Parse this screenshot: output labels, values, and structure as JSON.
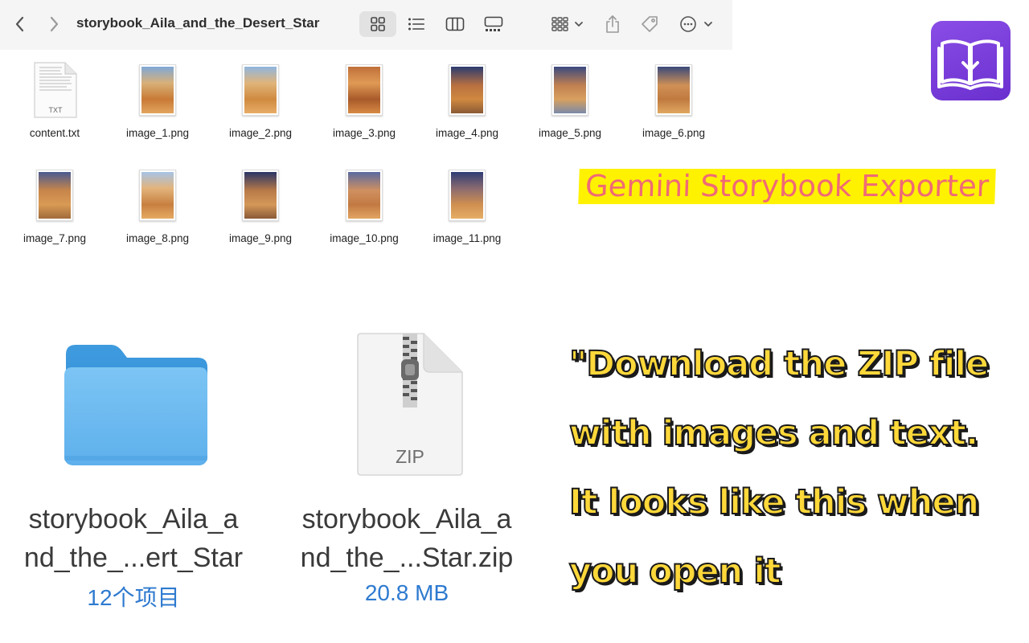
{
  "toolbar": {
    "title": "storybook_Aila_and_the_Desert_Star",
    "icons": [
      "chevron-left-icon",
      "chevron-right-icon",
      "grid-view-icon",
      "list-view-icon",
      "column-view-icon",
      "gallery-view-icon",
      "group-icon",
      "share-icon",
      "tag-icon",
      "more-icon"
    ]
  },
  "files": [
    {
      "name": "content.txt",
      "kind": "txt",
      "badge": "TXT"
    },
    {
      "name": "image_1.png",
      "kind": "png"
    },
    {
      "name": "image_2.png",
      "kind": "png"
    },
    {
      "name": "image_3.png",
      "kind": "png"
    },
    {
      "name": "image_4.png",
      "kind": "png"
    },
    {
      "name": "image_5.png",
      "kind": "png"
    },
    {
      "name": "image_6.png",
      "kind": "png"
    },
    {
      "name": "image_7.png",
      "kind": "png"
    },
    {
      "name": "image_8.png",
      "kind": "png"
    },
    {
      "name": "image_9.png",
      "kind": "png"
    },
    {
      "name": "image_10.png",
      "kind": "png"
    },
    {
      "name": "image_11.png",
      "kind": "png"
    }
  ],
  "big_items": {
    "folder": {
      "name_line1": "storybook_Aila_a",
      "name_line2": "nd_the_...ert_Star",
      "info": "12个项目"
    },
    "zip": {
      "name_line1": "storybook_Aila_a",
      "name_line2": "nd_the_...Star.zip",
      "info": "20.8 MB",
      "badge": "ZIP"
    }
  },
  "brand": {
    "title": "Gemini Storybook Exporter",
    "caption_lines": [
      "\"Download the ZIP file",
      "with images and text.",
      "It looks like this when",
      "you open it"
    ]
  },
  "colors": {
    "accent": "#2e7ad0",
    "logo": "#7a3fe0",
    "highlight": "#fff200",
    "title_text": "#f06a75",
    "caption_fill": "#ffd83a"
  }
}
